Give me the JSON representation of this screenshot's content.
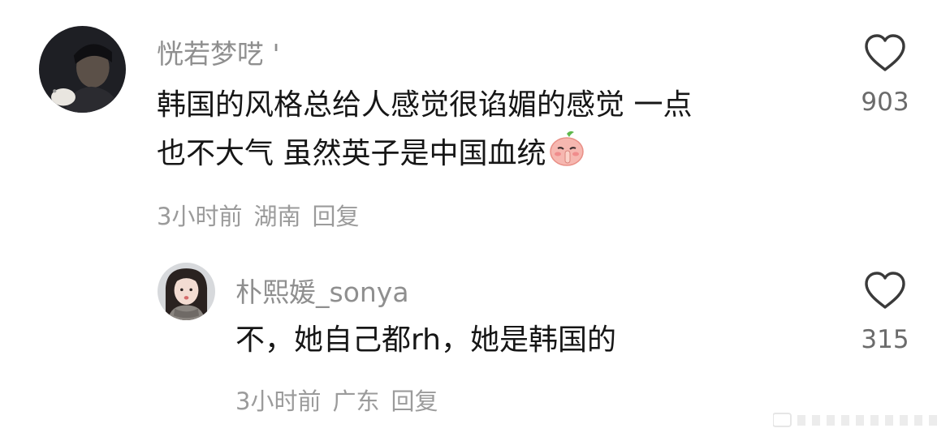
{
  "comments": [
    {
      "username": "恍若梦呓 '",
      "lines": [
        "韩国的风格总给人感觉很谄媚的感觉 一点",
        "也不大气 虽然英子是中国血统"
      ],
      "emoji_icon": "shush-emoji-icon",
      "time": "3小时前",
      "location": "湖南",
      "reply_label": "回复",
      "likes": "903"
    },
    {
      "username": "朴熙媛_sonya",
      "lines": [
        "不，她自己都rh，她是韩国的"
      ],
      "time": "3小时前",
      "location": "广东",
      "reply_label": "回复",
      "likes": "315"
    }
  ],
  "icons": {
    "like": "heart-outline-icon"
  },
  "colors": {
    "username": "#8f8f8f",
    "text": "#161616",
    "meta": "#9b9b9b"
  }
}
